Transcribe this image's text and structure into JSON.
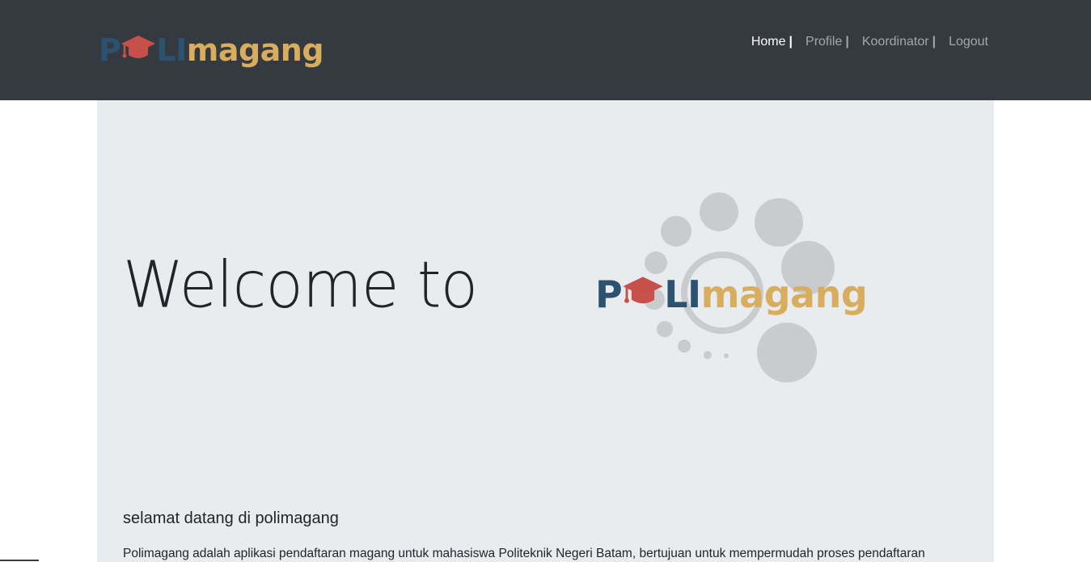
{
  "brand": {
    "logo_text": {
      "p": "P",
      "li": "LI",
      "magang": "magang"
    }
  },
  "nav": {
    "items": [
      {
        "label": "Home",
        "active": true
      },
      {
        "label": "Profile",
        "active": false
      },
      {
        "label": "Koordinator",
        "active": false
      },
      {
        "label": "Logout",
        "active": false
      }
    ],
    "separator": "|"
  },
  "hero": {
    "title": "Welcome to",
    "logo_text": {
      "p": "P",
      "li": "LI",
      "magang": "magang"
    },
    "subtitle": "selamat datang di polimagang",
    "description": "Polimagang adalah aplikasi pendaftaran magang untuk mahasiswa Politeknik Negeri Batam, bertujuan untuk mempermudah proses pendaftaran"
  },
  "colors": {
    "navbar_bg": "#343a40",
    "jumbotron_bg": "#e9ecef",
    "logo_blue": "#2c5270",
    "logo_gold": "#d8ad5e",
    "logo_cap_red": "#c8504a",
    "decor_circle": "#c9cbcd"
  },
  "icons": {
    "logo_cap": "graduation-cap-icon",
    "hero_decor": "loading-circles-decoration"
  }
}
